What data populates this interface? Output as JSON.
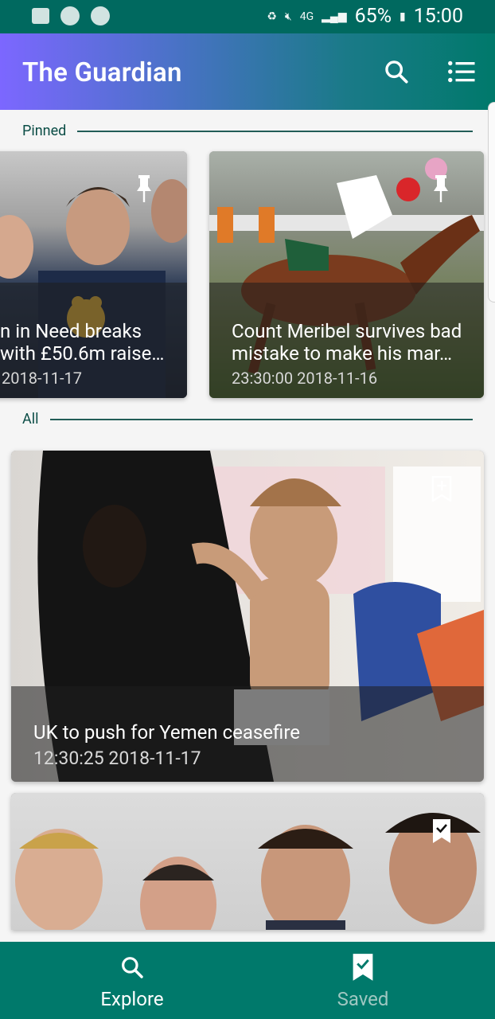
{
  "status_bar": {
    "network": "4G",
    "battery": "65%",
    "time": "15:00"
  },
  "app_bar": {
    "title": "The Guardian",
    "search_icon": "search-icon",
    "menu_icon": "list-menu-icon"
  },
  "sections": {
    "pinned": "Pinned",
    "all": "All"
  },
  "pinned_cards": [
    {
      "title": "n in Need breaks with £50.6m raise…",
      "title_line1": "n in Need breaks",
      "title_line2": "with £50.6m raise…",
      "time": "2018-11-17",
      "badge": "pin-icon"
    },
    {
      "title": "Count Meribel survives bad mistake to make his mar…",
      "title_line1": "Count Meribel survives bad",
      "title_line2": "mistake to make his mar…",
      "time": "23:30:00 2018-11-16",
      "badge": "pin-icon"
    }
  ],
  "all_cards": [
    {
      "title": "UK to push for Yemen ceasefire",
      "time": "12:30:25 2018-11-17",
      "badge": "bookmark-add-icon"
    },
    {
      "title": "",
      "time": "",
      "badge": "bookmark-check-icon"
    }
  ],
  "bottom_nav": {
    "explore": "Explore",
    "saved": "Saved"
  },
  "colors": {
    "primary": "#00796b",
    "status_bar": "#00695f",
    "gradient_start": "#7c67ff",
    "section_text": "#0b4d46"
  }
}
